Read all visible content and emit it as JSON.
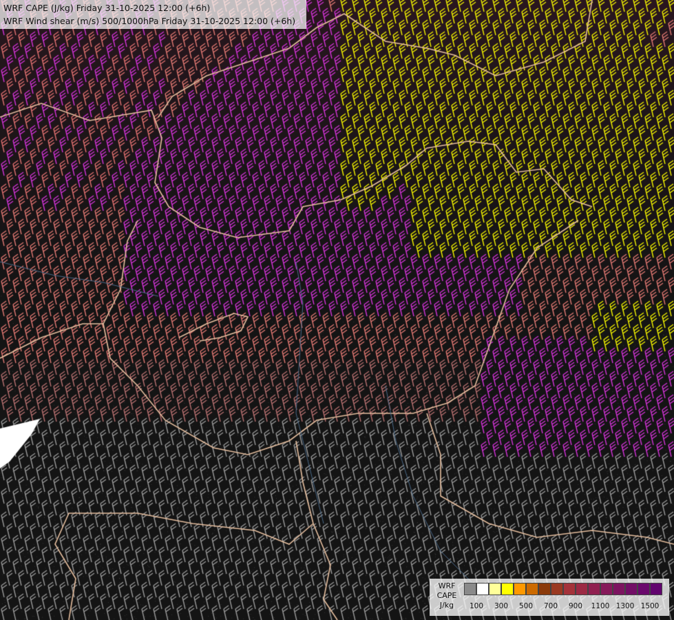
{
  "title": {
    "line1": "WRF CAPE (J/kg) Friday 31-10-2025 12:00 (+6h)",
    "line2": "WRF Wind shear (m/s) 500/1000hPa Friday 31-10-2025 12:00 (+6h)"
  },
  "legend": {
    "name_line1": "WRF",
    "name_line2": "CAPE",
    "name_line3": "J/kg",
    "colors": [
      "#8a8a8a",
      "#ffffff",
      "#ffff99",
      "#ffff00",
      "#ff9900",
      "#cc6a00",
      "#8b3a0a",
      "#9a3a22",
      "#a4333a",
      "#9c2a44",
      "#902050",
      "#861a5a",
      "#7c1460",
      "#720e66",
      "#6a086c",
      "#62046e"
    ],
    "tick_labels": [
      "100",
      "300",
      "500",
      "700",
      "900",
      "1100",
      "1300",
      "1500"
    ]
  }
}
